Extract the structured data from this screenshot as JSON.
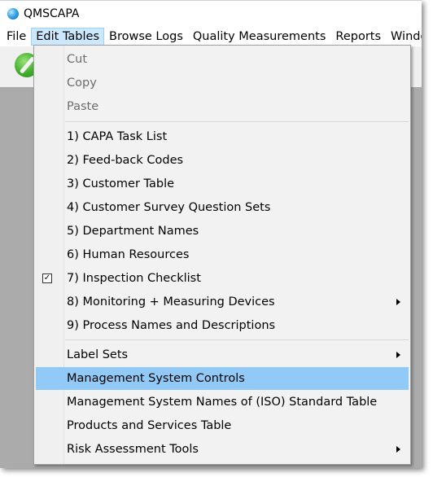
{
  "window": {
    "title": "QMSCAPA",
    "app_icon": "qmscapa-globe-icon"
  },
  "menubar": {
    "items": [
      {
        "label": "File"
      },
      {
        "label": "Edit Tables",
        "active": true
      },
      {
        "label": "Browse Logs"
      },
      {
        "label": "Quality Measurements"
      },
      {
        "label": "Reports"
      },
      {
        "label": "Windo"
      }
    ]
  },
  "toolbar": {
    "icon": "cancel-icon"
  },
  "edit_tables_menu": {
    "clipboard": [
      {
        "label": "Cut",
        "disabled": true
      },
      {
        "label": "Copy",
        "disabled": true
      },
      {
        "label": "Paste",
        "disabled": true
      }
    ],
    "tables": [
      {
        "label": "1) CAPA Task List"
      },
      {
        "label": "2) Feed-back Codes"
      },
      {
        "label": "3) Customer Table"
      },
      {
        "label": "4) Customer Survey Question Sets"
      },
      {
        "label": "5) Department Names"
      },
      {
        "label": "6) Human Resources"
      },
      {
        "label": "7) Inspection Checklist",
        "checked": true
      },
      {
        "label": "8) Monitoring + Measuring Devices",
        "submenu": true
      },
      {
        "label": "9) Process Names and Descriptions"
      }
    ],
    "other": [
      {
        "label": "Label Sets",
        "submenu": true
      },
      {
        "label": "Management System Controls",
        "highlighted": true
      },
      {
        "label": "Management System Names of (ISO) Standard Table"
      },
      {
        "label": "Products and Services Table"
      },
      {
        "label": "Risk Assessment Tools",
        "submenu": true
      }
    ]
  }
}
